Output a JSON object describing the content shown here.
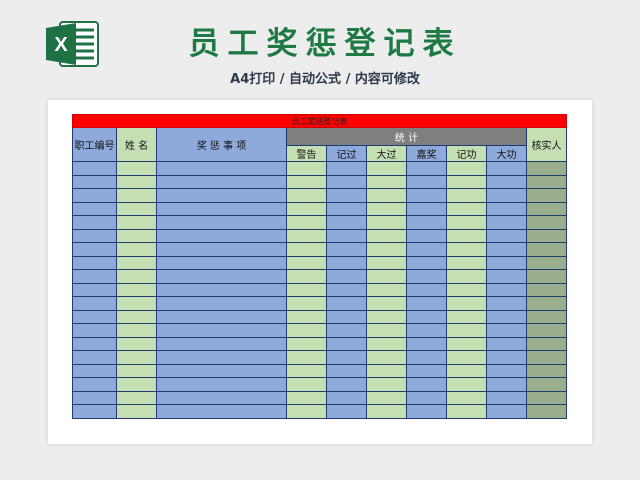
{
  "banner": {
    "title": "员工奖惩登记表",
    "subtitle": "A4打印 / 自动公式 / 内容可修改"
  },
  "colors": {
    "title_green": "#1e7a43",
    "header_red": "#ff0000",
    "column_blue": "#8eaadb",
    "column_green": "#c5dfb3",
    "stats_gray": "#7f7f7f",
    "verifier_olive": "#9aae8c"
  },
  "sheet": {
    "caption": "员工奖惩登记表",
    "columns": {
      "employee_id": "职工编号",
      "name": "姓  名",
      "matter": "奖 惩 事 项",
      "stats_group": "统          计",
      "verifier": "核实人"
    },
    "stat_columns": [
      "警告",
      "记过",
      "大过",
      "嘉奖",
      "记功",
      "大功"
    ],
    "empty_rows": 19
  },
  "icons": {
    "logo": "excel-icon"
  }
}
